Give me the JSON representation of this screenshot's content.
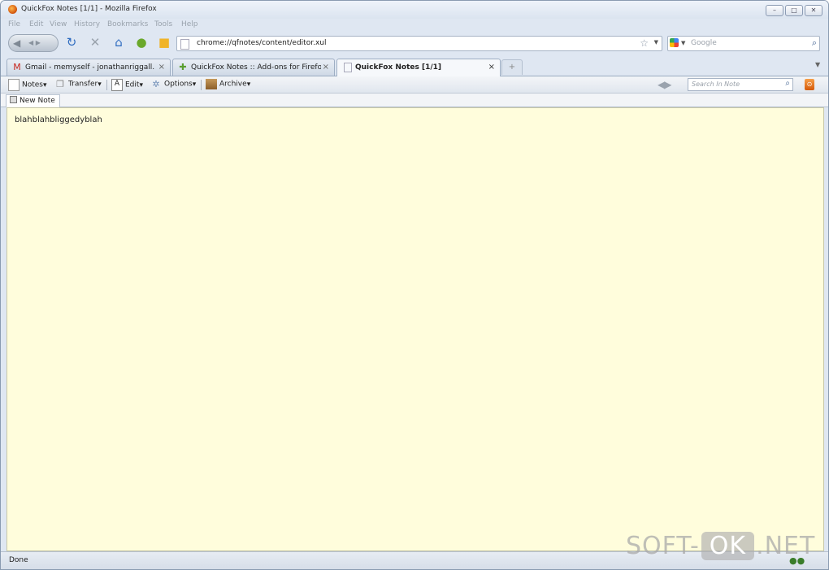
{
  "window": {
    "title": "QuickFox Notes [1/1] - Mozilla Firefox",
    "controls": {
      "minimize": "–",
      "maximize": "□",
      "close": "✕"
    }
  },
  "menubar": {
    "items": [
      "File",
      "Edit",
      "View",
      "History",
      "Bookmarks",
      "Tools",
      "Help"
    ]
  },
  "navbar": {
    "back_label": "◀ ▶",
    "url": "chrome://qfnotes/content/editor.xul",
    "search_placeholder": "Google"
  },
  "tabs": [
    {
      "label": "Gmail - memyself - jonathanriggall...",
      "icon": "gmail-icon",
      "active": false
    },
    {
      "label": "QuickFox Notes :: Add-ons for Firefox",
      "icon": "addon-icon",
      "active": false
    },
    {
      "label": "QuickFox Notes [1/1]",
      "icon": "page-icon",
      "active": true
    }
  ],
  "tab_close": "×",
  "new_tab": "+",
  "notes_toolbar": {
    "notes": "Notes",
    "transfer": "Transfer",
    "edit": "Edit",
    "options": "Options",
    "archive": "Archive",
    "search_placeholder": "Search In Note"
  },
  "note_tabs": [
    {
      "label": "New Note"
    }
  ],
  "editor": {
    "content": "blahblahbliggedyblah"
  },
  "status": {
    "text": "Done"
  },
  "watermark": {
    "left": "SOFT-",
    "mid": "OK",
    "right": ".NET"
  },
  "colors": {
    "editor_bg": "#fffddc",
    "chrome_bg": "#dfe7f2"
  }
}
